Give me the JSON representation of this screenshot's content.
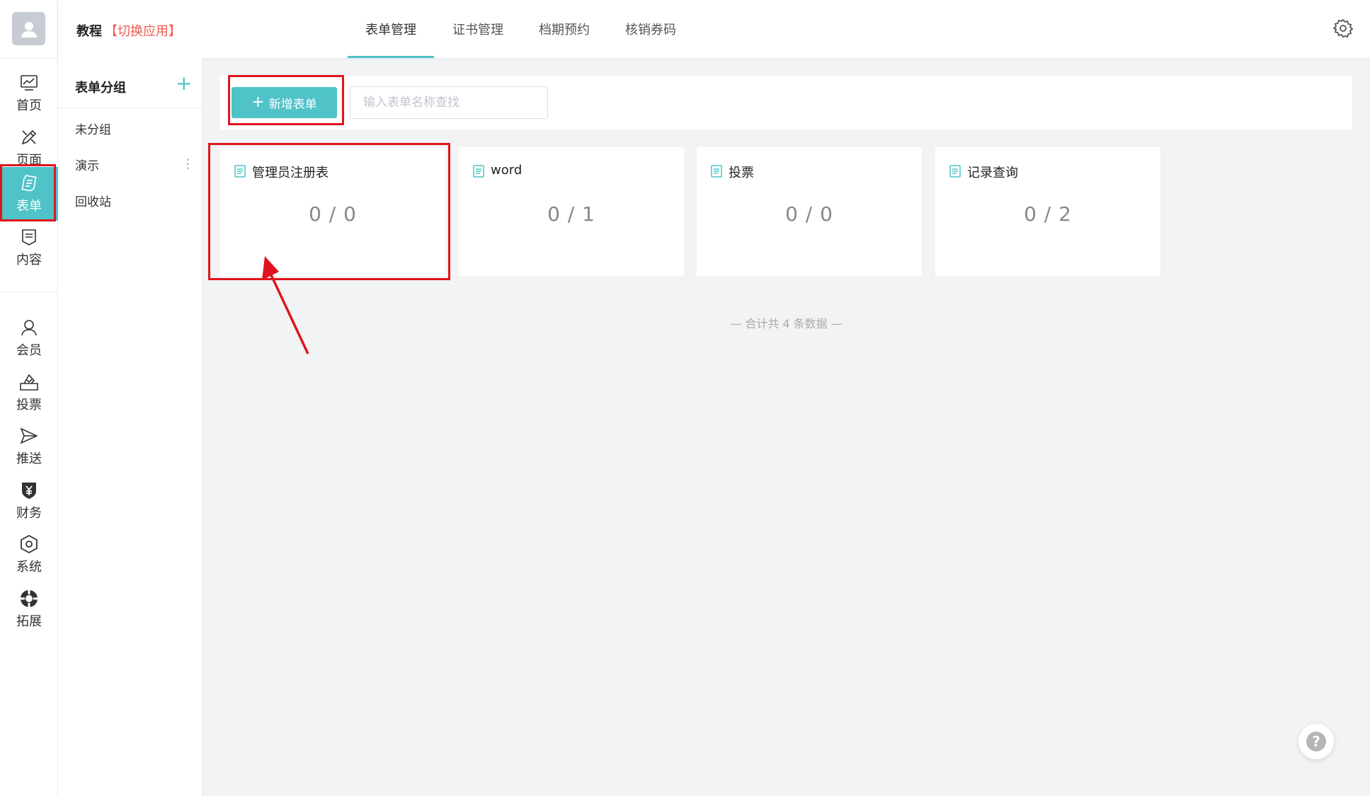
{
  "app": {
    "title": "教程",
    "switch_label": "【切换应用】"
  },
  "rail": {
    "items": [
      {
        "label": "首页",
        "icon": "chart-icon"
      },
      {
        "label": "页面",
        "icon": "brush-icon"
      },
      {
        "label": "表单",
        "icon": "form-icon",
        "active": true
      },
      {
        "label": "内容",
        "icon": "document-icon"
      },
      {
        "label": "会员",
        "icon": "user-icon"
      },
      {
        "label": "投票",
        "icon": "vote-icon"
      },
      {
        "label": "推送",
        "icon": "send-icon"
      },
      {
        "label": "财务",
        "icon": "yen-shield-icon"
      },
      {
        "label": "系统",
        "icon": "hex-gear-icon"
      },
      {
        "label": "拓展",
        "icon": "lifebuoy-icon"
      }
    ]
  },
  "top_tabs": [
    {
      "label": "表单管理",
      "active": true
    },
    {
      "label": "证书管理"
    },
    {
      "label": "档期预约"
    },
    {
      "label": "核销券码"
    }
  ],
  "groups": {
    "title": "表单分组",
    "add_symbol": "+",
    "items": [
      {
        "label": "未分组"
      },
      {
        "label": "演示"
      },
      {
        "label": "回收站"
      }
    ]
  },
  "toolbar": {
    "add_label": "新增表单",
    "add_symbol": "+",
    "search_placeholder": "输入表单名称查找",
    "search_value": ""
  },
  "forms": [
    {
      "name": "管理员注册表",
      "stat": "0 / 0"
    },
    {
      "name": "word",
      "stat": "0 / 1"
    },
    {
      "name": "投票",
      "stat": "0 / 0"
    },
    {
      "name": "记录查询",
      "stat": "0 / 2"
    }
  ],
  "total_text": "— 合计共 4 条数据 —",
  "help_symbol": "?",
  "colors": {
    "accent": "#4fc3c8",
    "switch": "#f05a52",
    "annotation": "#e0141c"
  }
}
